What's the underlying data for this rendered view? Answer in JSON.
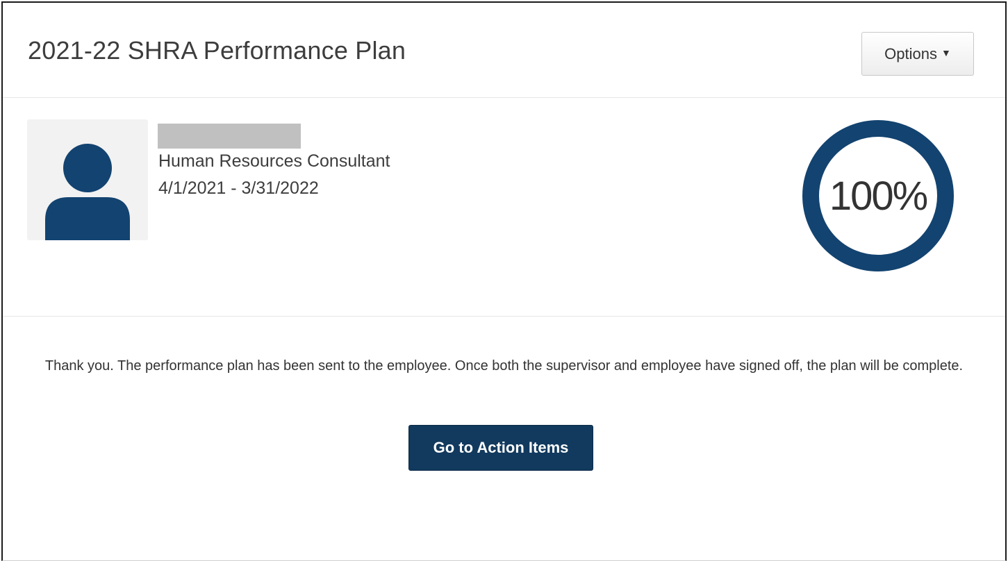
{
  "header": {
    "title": "2021-22 SHRA Performance Plan",
    "options_label": "Options"
  },
  "profile": {
    "job_title": "Human Resources Consultant",
    "date_range": "4/1/2021 - 3/31/2022",
    "progress_text": "100%",
    "progress_fraction": 1.0,
    "ring_color": "#134370"
  },
  "message": {
    "text": "Thank you. The performance plan has been sent to the employee. Once both the supervisor and employee have signed off, the plan will be complete.",
    "button_label": "Go to Action Items"
  },
  "icons": {
    "avatar": "user-silhouette-icon",
    "options_caret": "caret-down-icon"
  },
  "colors": {
    "brand_dark": "#123a5e",
    "avatar_fill": "#134370"
  }
}
